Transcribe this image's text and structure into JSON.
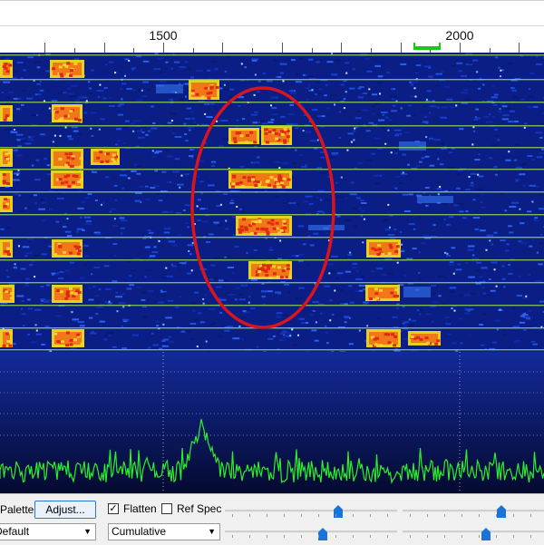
{
  "ruler": {
    "labels": [
      {
        "text": "1500",
        "freq": 1500
      },
      {
        "text": "2000",
        "freq": 2000
      }
    ]
  },
  "waterfall": {
    "annotation_color": "#d8141e",
    "grid_line_color": "#8fd24f"
  },
  "spectrum": {
    "trace_color": "#2cf02c"
  },
  "controls": {
    "palette_label": "Palette",
    "adjust_button": "Adjust...",
    "flatten_label": "Flatten",
    "flatten_checked": true,
    "ref_spec_label": "Ref Spec",
    "ref_spec_checked": false,
    "palette_select_value": "Default",
    "spec_select_value": "Cumulative",
    "select_arrow_icon": "chevron-down-icon",
    "check_glyph": "✓",
    "arrow_glyph": "▼"
  }
}
